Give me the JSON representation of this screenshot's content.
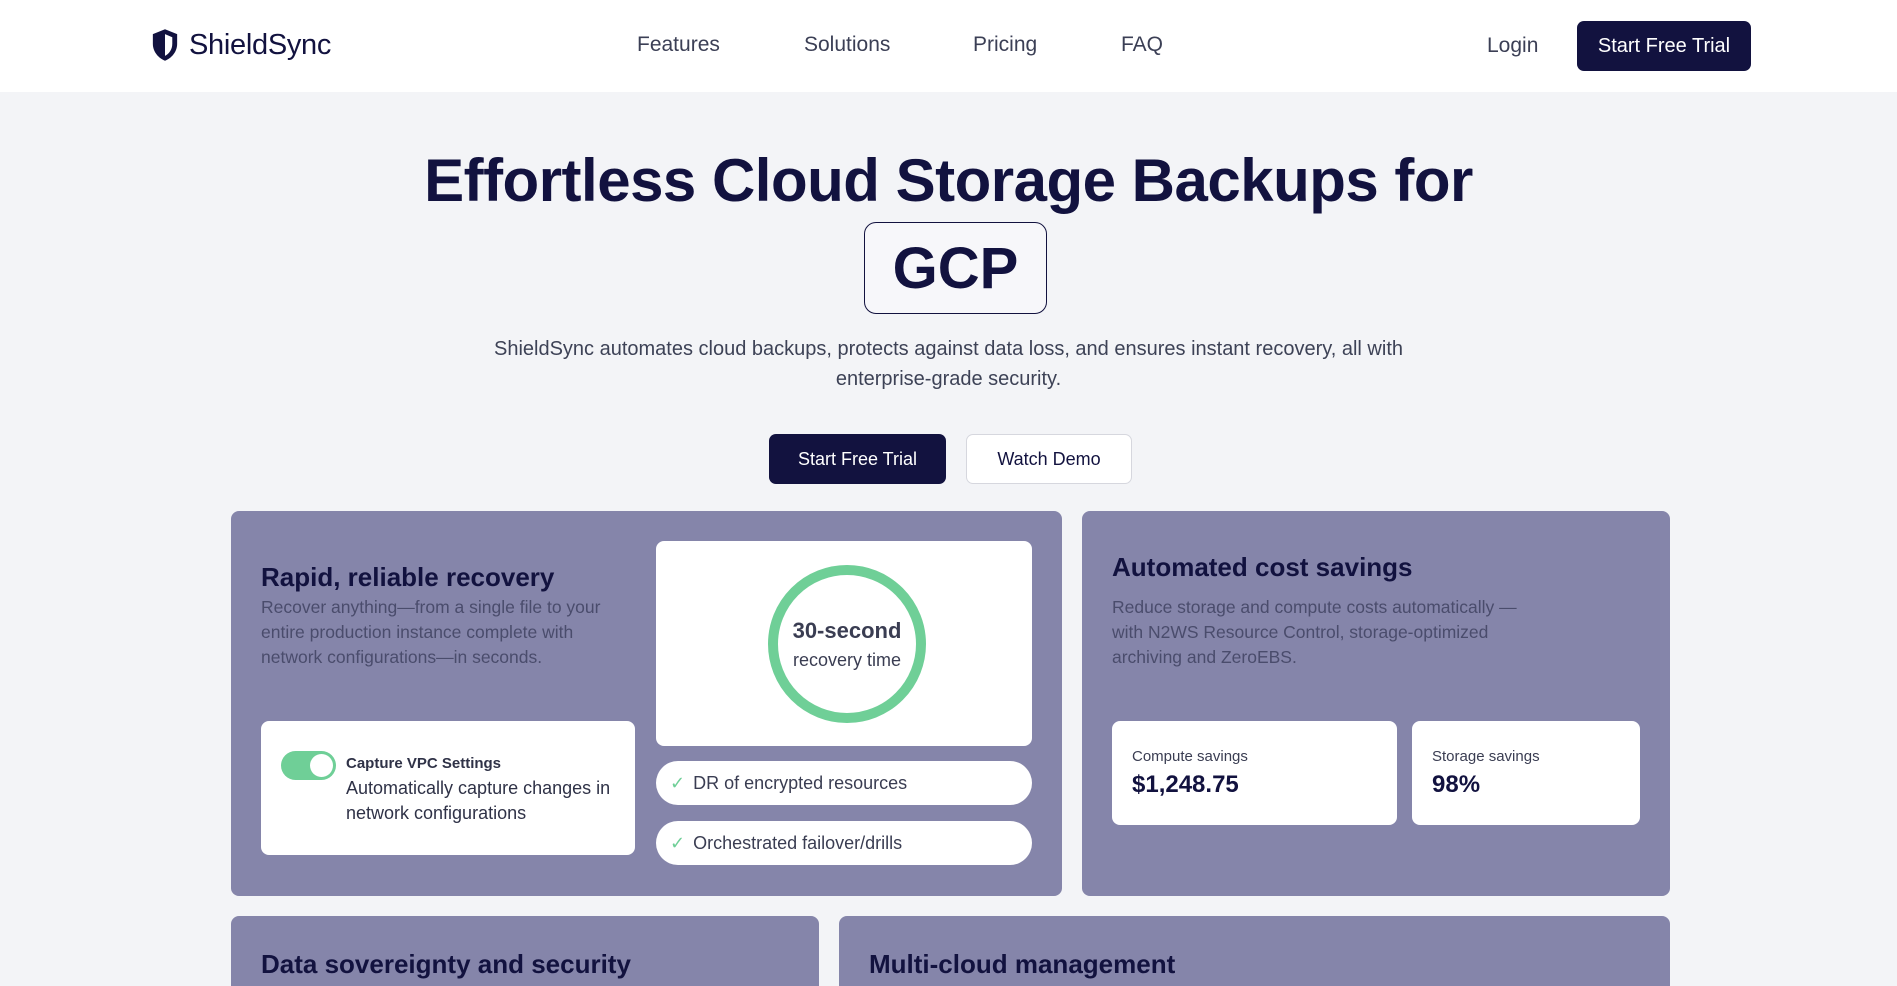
{
  "brand": {
    "name": "ShieldSync"
  },
  "nav": {
    "links": [
      "Features",
      "Solutions",
      "Pricing",
      "FAQ"
    ],
    "login": "Login",
    "cta": "Start Free Trial"
  },
  "hero": {
    "title": "Effortless Cloud Storage Backups for",
    "highlight": "GCP",
    "subtitle": "ShieldSync automates cloud backups, protects against data loss, and ensures instant recovery, all with enterprise-grade security.",
    "primary_cta": "Start Free Trial",
    "secondary_cta": "Watch Demo"
  },
  "recovery_card": {
    "title": "Rapid, reliable recovery",
    "description": "Recover anything—from a single file to your entire production instance complete with network configurations—in seconds.",
    "ring_value": "30-second",
    "ring_label": "recovery time",
    "toggle_label": "Capture VPC Settings",
    "toggle_description": "Automatically capture changes in network configurations",
    "toggle_on": true,
    "features": [
      "DR of encrypted resources",
      "Orchestrated failover/drills"
    ]
  },
  "savings_card": {
    "title": "Automated cost savings",
    "description": "Reduce storage and compute costs automatically — with N2WS Resource Control, storage-optimized archiving and ZeroEBS.",
    "stats": [
      {
        "label": "Compute savings",
        "value": "$1,248.75"
      },
      {
        "label": "Storage savings",
        "value": "98%"
      }
    ]
  },
  "bottom_cards": [
    {
      "title": "Data sovereignty and security"
    },
    {
      "title": "Multi-cloud management"
    }
  ],
  "colors": {
    "primary": "#12123f",
    "card": "#8585aa",
    "accent": "#6fcf97",
    "background": "#f3f4f7"
  }
}
